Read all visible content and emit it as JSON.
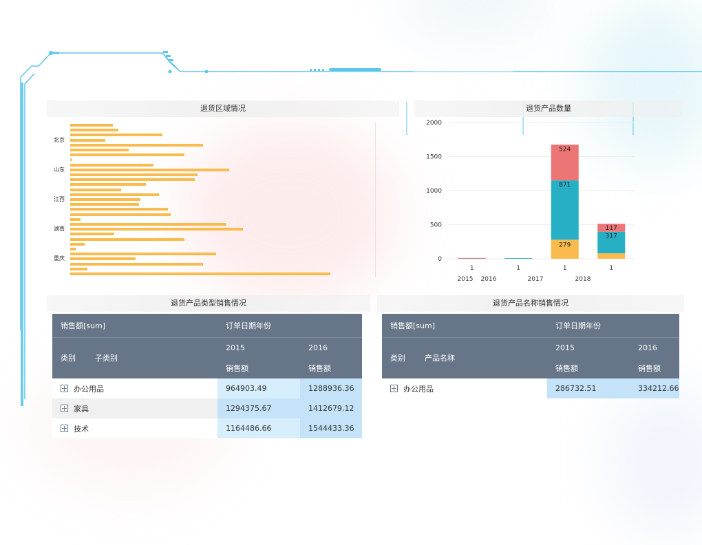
{
  "colors": {
    "bar_yellow": "#f9bb4d",
    "bar_teal": "#27afc5",
    "bar_red": "#ec7575",
    "table_header": "#667587",
    "cell_blue_light": "#d7eefc",
    "cell_blue": "#c4e3f8",
    "frame_line": "#5ec6e8"
  },
  "panels": {
    "region": {
      "title": "退货区域情况"
    },
    "product_count": {
      "title": "退货产品数量"
    },
    "category_sales": {
      "title": "退货产品类型销售情况"
    },
    "name_sales": {
      "title": "退货产品名称销售情况"
    }
  },
  "region_chart": {
    "type": "bar",
    "orientation": "horizontal",
    "labels": [
      "北京",
      "山东",
      "江西",
      "湖南",
      "重庆"
    ],
    "values": [
      0.165,
      0.185,
      0.355,
      0.135,
      0.51,
      0.225,
      0.44,
      0.005,
      0.32,
      0.61,
      0.49,
      0.48,
      0.29,
      0.195,
      0.34,
      0.27,
      0.265,
      0.375,
      0.385,
      0.04,
      0.6,
      0.665,
      0.17,
      0.44,
      0.055,
      0.02,
      0.56,
      0.25,
      0.51,
      0.065,
      1.0
    ]
  },
  "chart_data": {
    "type": "bar",
    "stacked": true,
    "title": "退货产品数量",
    "x": [
      "1",
      "1",
      "1",
      "1"
    ],
    "year_labels": [
      "2015",
      "2016",
      "2017",
      "2018"
    ],
    "ylim": [
      0,
      2000
    ],
    "yticks": [
      0,
      500,
      1000,
      1500,
      2000
    ],
    "series": [
      {
        "color": "#f9bb4d",
        "values": [
          0,
          0,
          279,
          80
        ]
      },
      {
        "color": "#27afc5",
        "values": [
          8,
          10,
          871,
          317
        ]
      },
      {
        "color": "#ec7575",
        "values": [
          4,
          0,
          524,
          117
        ]
      }
    ],
    "data_labels": [
      [
        "",
        "",
        "279",
        ""
      ],
      [
        "",
        "",
        "871",
        "317"
      ],
      [
        "",
        "",
        "524",
        "117"
      ]
    ]
  },
  "category_table": {
    "measure": "销售额[sum]",
    "column_dim": "订单日期年份",
    "row_dims": [
      "类别",
      "子类别"
    ],
    "years": [
      "2015",
      "2016"
    ],
    "value_label": "销售额",
    "rows": [
      {
        "label": "办公用品",
        "v2015": "964903.49",
        "v2016": "1288936.36"
      },
      {
        "label": "家具",
        "v2015": "1294375.67",
        "v2016": "1412679.12"
      },
      {
        "label": "技术",
        "v2015": "1164486.66",
        "v2016": "1544433.36"
      }
    ]
  },
  "name_table": {
    "measure": "销售额[sum]",
    "column_dim": "订单日期年份",
    "row_dims": [
      "类别",
      "产品名称"
    ],
    "years": [
      "2015",
      "2016"
    ],
    "value_label": "销售额",
    "rows": [
      {
        "label": "办公用品",
        "v2015": "286732.51",
        "v2016": "334212.66"
      }
    ]
  }
}
